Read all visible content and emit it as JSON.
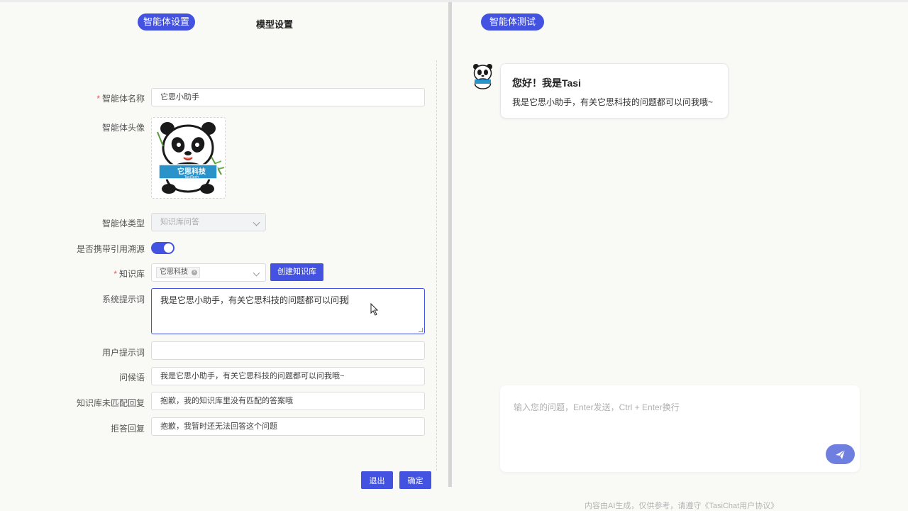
{
  "tabs": {
    "agent_settings": "智能体设置",
    "model_settings": "模型设置",
    "agent_test": "智能体测试"
  },
  "form": {
    "name_label": "智能体名称",
    "name_value": "它思小助手",
    "avatar_label": "智能体头像",
    "avatar_badge_text": "它思科技",
    "avatar_badge_sub": "TasiTech",
    "type_label": "智能体类型",
    "type_value": "知识库问答",
    "citation_label": "是否携带引用溯源",
    "citation_enabled": true,
    "kb_label": "知识库",
    "kb_tag": "它思科技",
    "kb_create_button": "创建知识库",
    "system_prompt_label": "系统提示词",
    "system_prompt_value": "我是它思小助手，有关它思科技的问题都可以问我",
    "user_prompt_label": "用户提示词",
    "user_prompt_value": "",
    "greeting_label": "问候语",
    "greeting_value": "我是它思小助手，有关它思科技的问题都可以问我哦~",
    "no_match_label": "知识库未匹配回复",
    "no_match_value": "抱歉，我的知识库里没有匹配的答案哦",
    "refuse_label": "拒答回复",
    "refuse_value": "抱歉，我暂时还无法回答这个问题",
    "required_mark": "*",
    "exit_button": "退出",
    "confirm_button": "确定"
  },
  "chat": {
    "greeting_title": "您好！我是Tasi",
    "greeting_text": "我是它思小助手，有关它思科技的问题都可以问我哦~",
    "input_placeholder": "输入您的问题，Enter发送，Ctrl + Enter换行",
    "footer": "内容由AI生成，仅供参考，请遵守《TasiChat用户协议》"
  },
  "colors": {
    "accent": "#4352e1",
    "send_button": "#6e7fe0",
    "background": "#f9f9f6"
  },
  "icons": {
    "send": "paper-plane-icon",
    "dropdown": "chevron-down-icon",
    "tag_close": "close-icon",
    "cursor": "mouse-pointer-icon"
  }
}
